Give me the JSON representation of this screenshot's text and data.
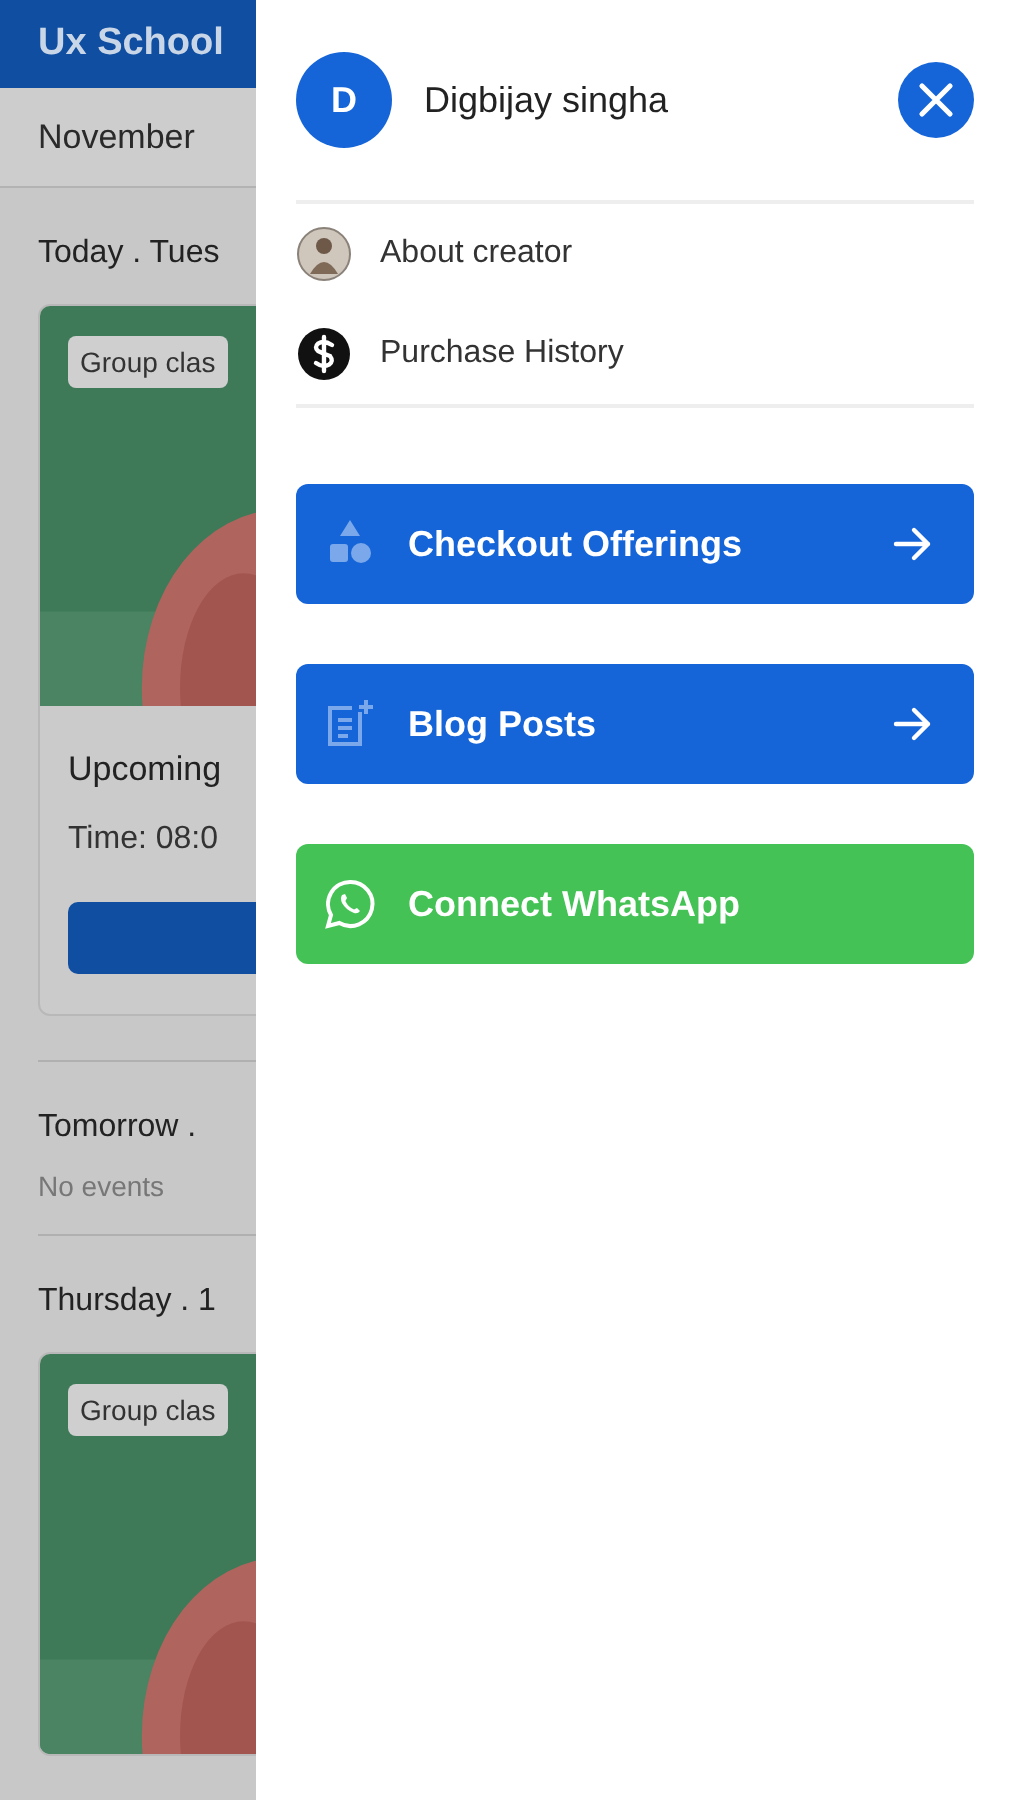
{
  "background": {
    "app_title": "Ux School",
    "month": "November",
    "sections": [
      {
        "heading": "Today . Tues",
        "events": [
          {
            "tag": "Group clas",
            "title": "Upcoming",
            "time": "Time: 08:0",
            "has_button": true,
            "cut": false
          }
        ]
      },
      {
        "heading": "Tomorrow .",
        "empty_text": "No events"
      },
      {
        "heading": "Thursday . 1",
        "events": [
          {
            "tag": "Group clas",
            "cut": true
          }
        ]
      }
    ]
  },
  "drawer": {
    "user": {
      "initial": "D",
      "name": "Digbijay singha"
    },
    "menu": [
      {
        "kind": "avatar",
        "label": "About creator"
      },
      {
        "kind": "dollar",
        "label": "Purchase History"
      }
    ],
    "buttons": [
      {
        "kind": "offerings",
        "label": "Checkout Offerings",
        "color": "#1565d8",
        "arrow": true
      },
      {
        "kind": "blog",
        "label": "Blog Posts",
        "color": "#1565d8",
        "arrow": true
      },
      {
        "kind": "whatsapp",
        "label": "Connect WhatsApp",
        "color": "#45c256",
        "arrow": false
      }
    ]
  }
}
